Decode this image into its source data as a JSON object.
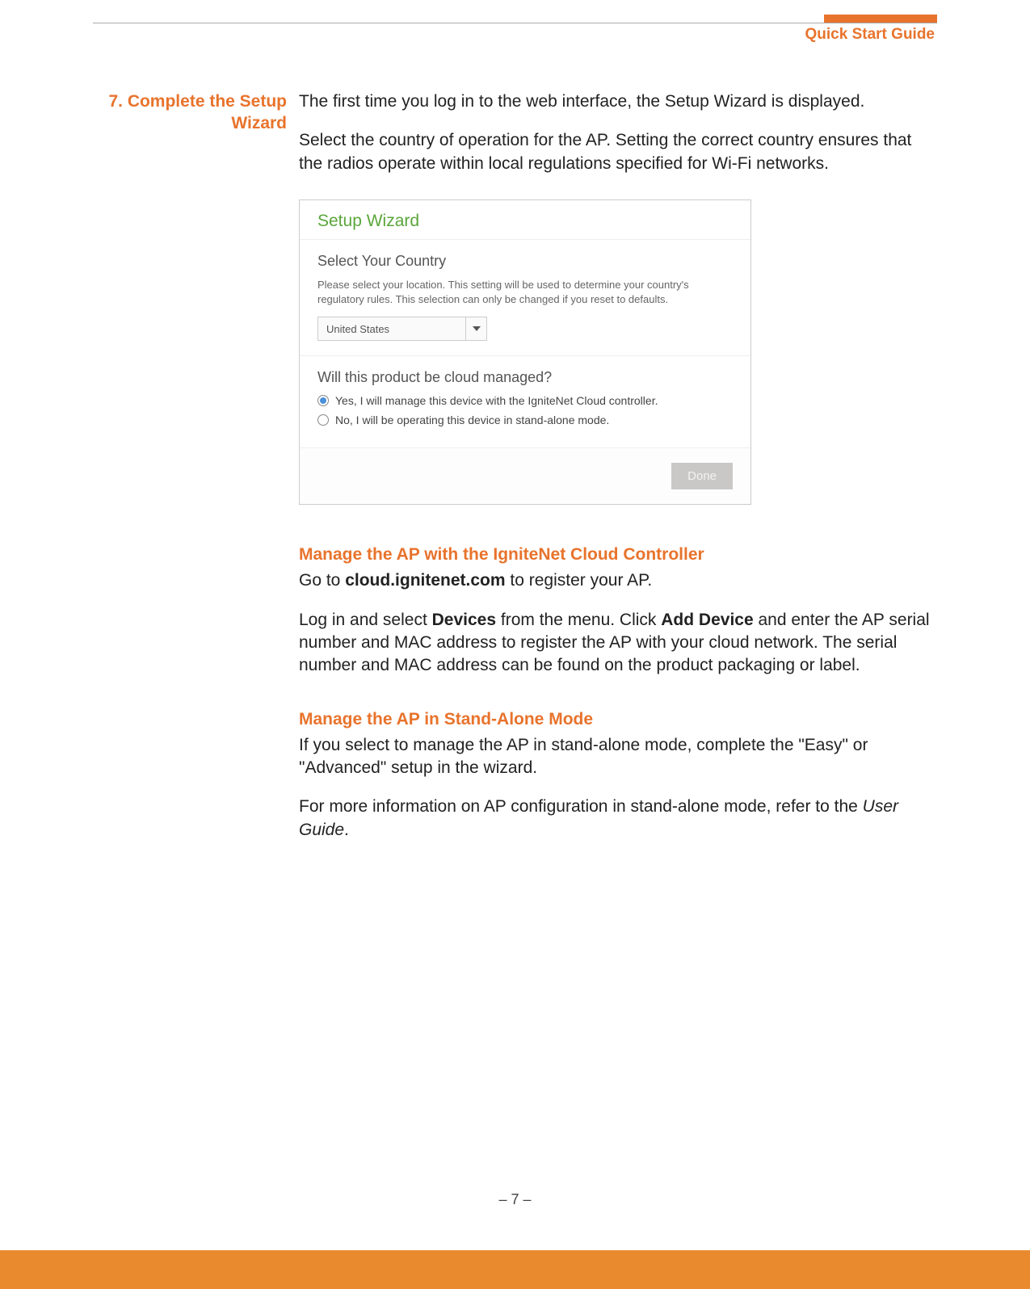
{
  "header": {
    "title": "Quick Start Guide"
  },
  "section": {
    "number_title": "7. Complete the Setup Wizard"
  },
  "body": {
    "p1": "The first time you log in to the web interface, the Setup Wizard is displayed.",
    "p2": "Select the country of operation for the AP. Setting the correct country ensures that the radios operate within local regulations specified for Wi-Fi networks."
  },
  "wizard": {
    "title": "Setup Wizard",
    "country_heading": "Select Your Country",
    "country_help": "Please select your location. This setting will be used to determine your country's regulatory rules. This selection can only be changed if you reset to defaults.",
    "country_value": "United States",
    "cloud_heading": "Will this product be cloud managed?",
    "radio_yes": "Yes, I will manage this device with the IgniteNet Cloud controller.",
    "radio_no": "No, I will be operating this device in stand-alone mode.",
    "done_label": "Done"
  },
  "cloud": {
    "heading": "Manage the AP with the IgniteNet Cloud Controller",
    "p1_pre": "Go to ",
    "p1_bold": "cloud.ignitenet.com",
    "p1_post": " to register your AP.",
    "p2_a": "Log in and select ",
    "p2_b": "Devices",
    "p2_c": " from the menu. Click ",
    "p2_d": "Add Device",
    "p2_e": " and enter the AP serial number and MAC address to register the AP with your cloud network. The serial number and MAC address can be found on the product packaging or label."
  },
  "standalone": {
    "heading": "Manage the AP in Stand-Alone Mode",
    "p1": "If you select to manage the AP in stand-alone mode, complete the \"Easy\" or \"Advanced\" setup in the wizard.",
    "p2_a": "For more information on AP configuration in stand-alone mode, refer to the ",
    "p2_b": "User Guide",
    "p2_c": "."
  },
  "footer": {
    "page": "–  7  –"
  }
}
